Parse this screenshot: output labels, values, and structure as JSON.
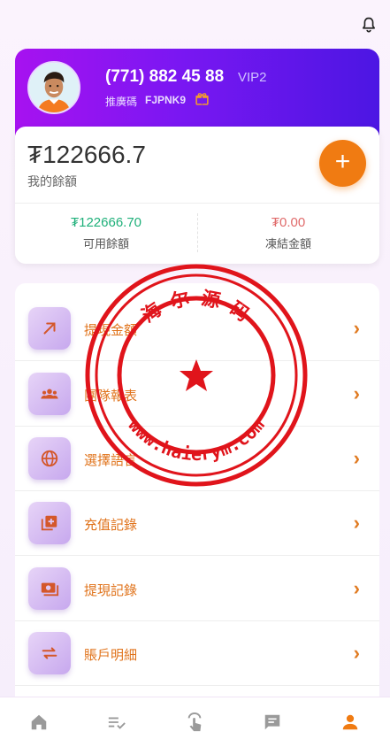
{
  "header": {
    "bell_icon": "bell-icon"
  },
  "profile": {
    "phone": "(771) 882 45 88",
    "vip": "VIP2",
    "referral_label": "推廣碼",
    "referral_code": "FJPNK9",
    "gift_icon": "gift-icon"
  },
  "balance": {
    "amount": "₮122666.7",
    "label": "我的餘額",
    "plus_label": "+",
    "available_value": "₮122666.70",
    "available_label": "可用餘額",
    "frozen_value": "₮0.00",
    "frozen_label": "凍結金額"
  },
  "menu": [
    {
      "label": "提現金額",
      "icon": "arrow-up-right-icon"
    },
    {
      "label": "團隊報表",
      "icon": "team-icon"
    },
    {
      "label": "選擇語言",
      "icon": "globe-icon"
    },
    {
      "label": "充值記錄",
      "icon": "add-record-icon"
    },
    {
      "label": "提現記錄",
      "icon": "withdraw-record-icon"
    },
    {
      "label": "賬戶明細",
      "icon": "swap-icon"
    }
  ],
  "watermark": {
    "text_top": "海 尔 源 码",
    "text_bottom": "www.haierym.com"
  },
  "bottom_nav": {
    "tabs": [
      {
        "icon": "home-icon",
        "label": ""
      },
      {
        "icon": "list-check-icon",
        "label": ""
      },
      {
        "icon": "touch-icon",
        "label": ""
      },
      {
        "icon": "message-icon",
        "label": ""
      },
      {
        "icon": "person-icon",
        "label": ""
      }
    ],
    "active_index": 4
  },
  "colors": {
    "accent_orange": "#f07b12",
    "header_gradient_start": "#a712f0",
    "header_gradient_end": "#4c16e3",
    "available_green": "#1fb07a",
    "frozen_red": "#e06a6a",
    "stamp_red": "#e0141b"
  }
}
